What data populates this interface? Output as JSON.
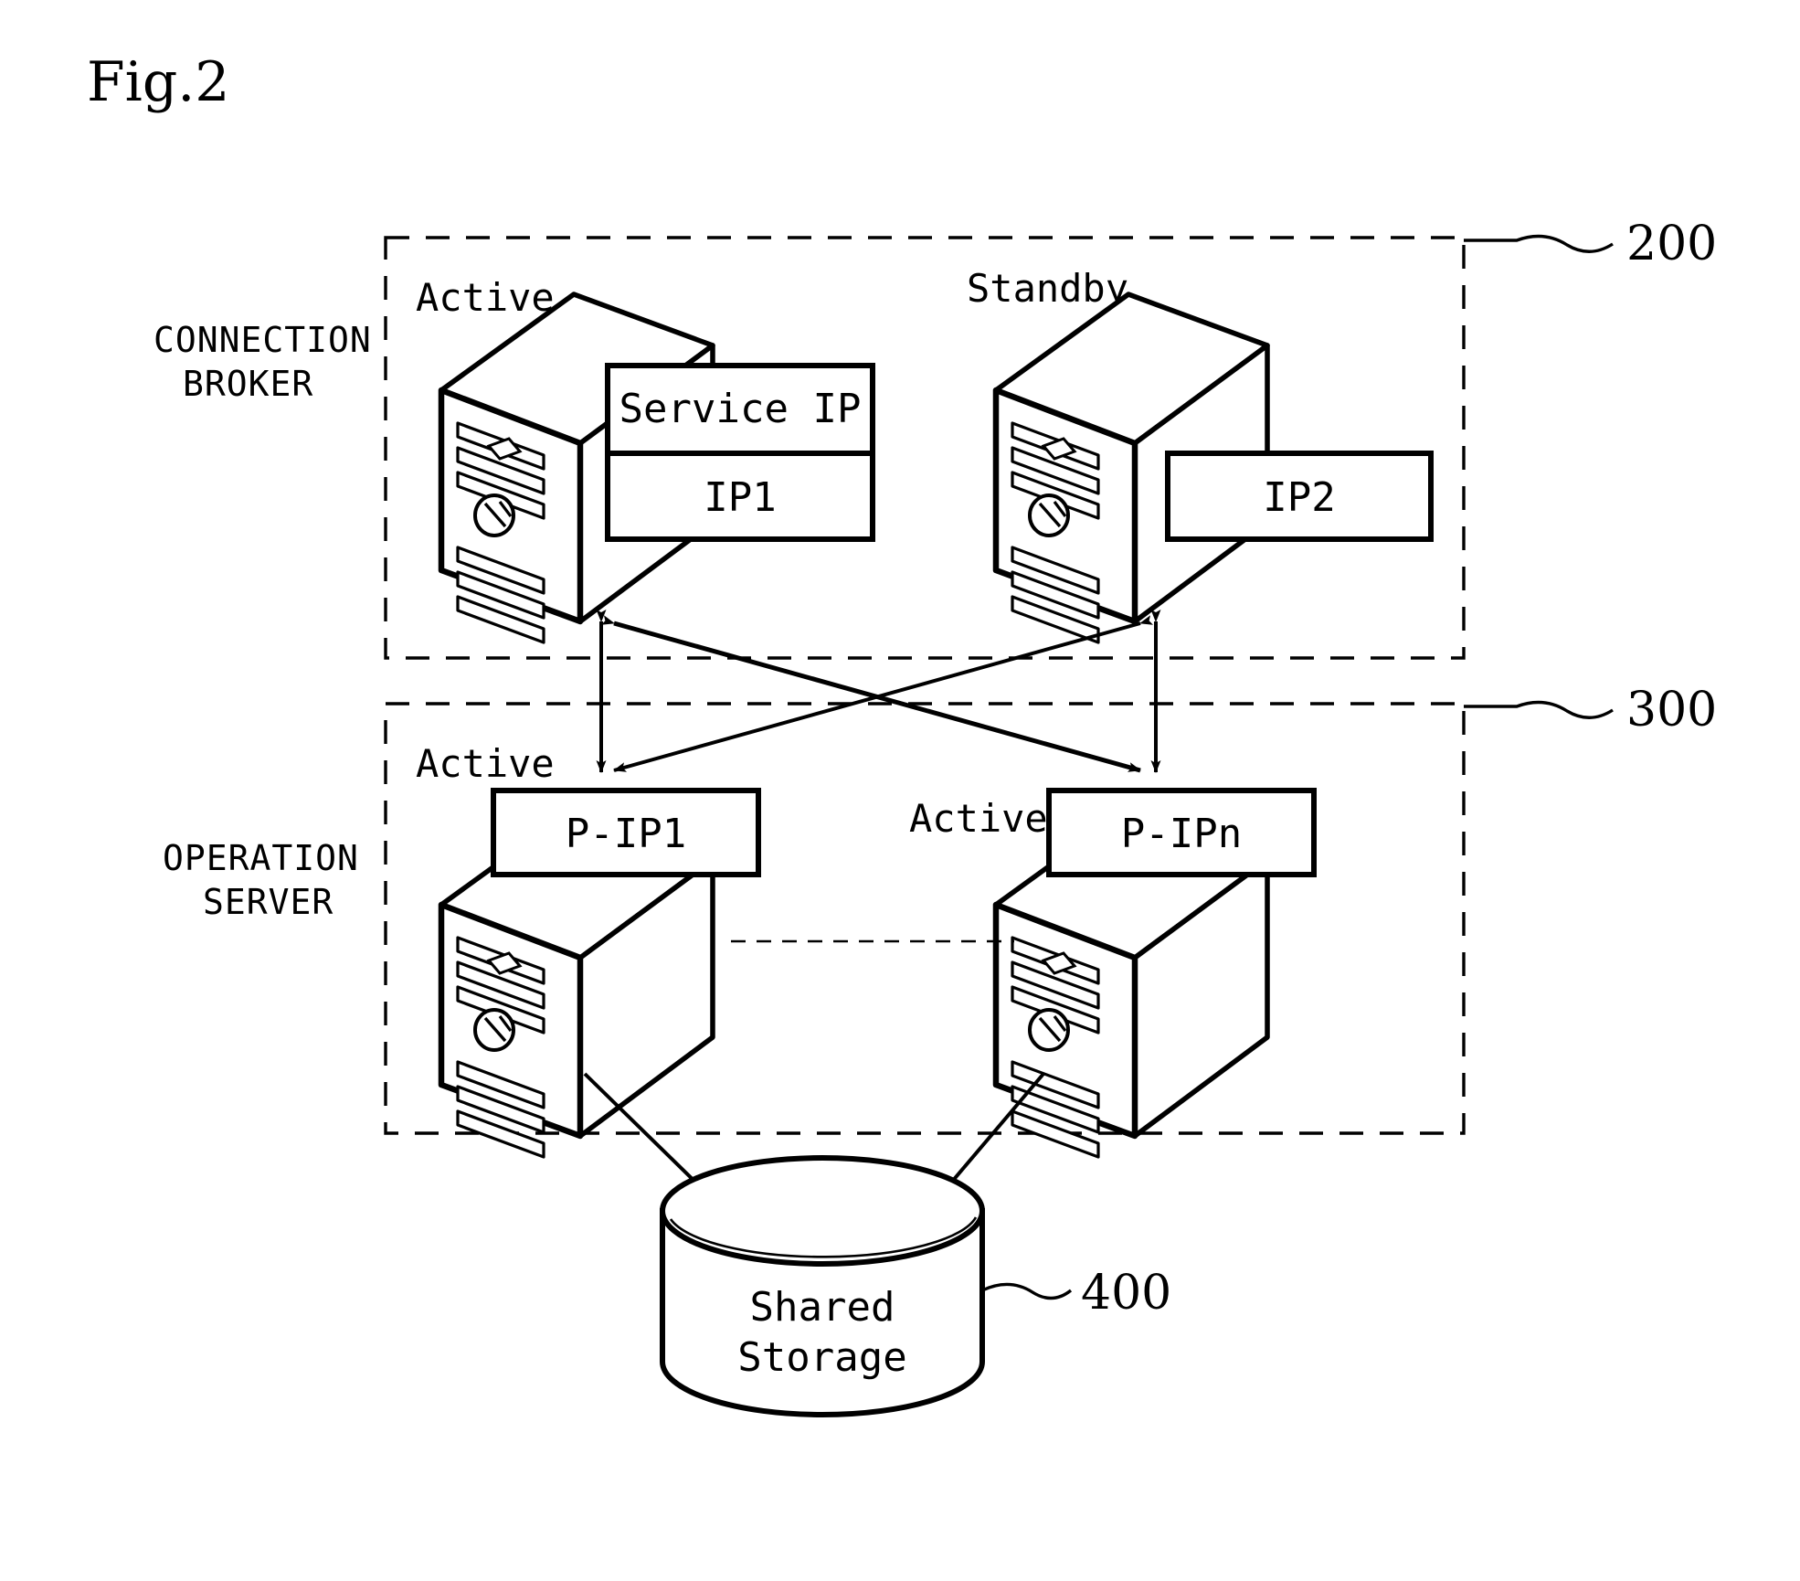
{
  "figure": {
    "label": "Fig.2"
  },
  "side_labels": [
    {
      "name": "connection-broker",
      "line1": "CONNECTION",
      "line2": "BROKER"
    },
    {
      "name": "operation-server",
      "line1": "OPERATION",
      "line2": "SERVER"
    }
  ],
  "reference_numerals": [
    {
      "name": "ref-200",
      "value": "200"
    },
    {
      "name": "ref-300",
      "value": "300"
    },
    {
      "name": "ref-400",
      "value": "400"
    }
  ],
  "connection_broker": {
    "group_ref": "200",
    "nodes": [
      {
        "name": "broker-active",
        "state_label": "Active",
        "boxes": [
          {
            "name": "service-ip-box",
            "text": "Service IP"
          },
          {
            "name": "ip1-box",
            "text": "IP1"
          }
        ]
      },
      {
        "name": "broker-standby",
        "state_label": "Standby",
        "boxes": [
          {
            "name": "ip2-box",
            "text": "IP2"
          }
        ]
      }
    ]
  },
  "operation_server": {
    "group_ref": "300",
    "nodes": [
      {
        "name": "operation-server-1",
        "state_label": "Active",
        "boxes": [
          {
            "name": "p-ip1-box",
            "text": "P-IP1"
          }
        ]
      },
      {
        "name": "operation-server-n",
        "state_label": "Active",
        "boxes": [
          {
            "name": "p-ipn-box",
            "text": "P-IPn"
          }
        ]
      }
    ],
    "continuation_indicator": "dashed-ellipsis-line"
  },
  "storage": {
    "name": "shared-storage",
    "ref": "400",
    "line1": "Shared",
    "line2": "Storage"
  },
  "colors": {
    "stroke": "#000000",
    "fill": "#ffffff"
  }
}
